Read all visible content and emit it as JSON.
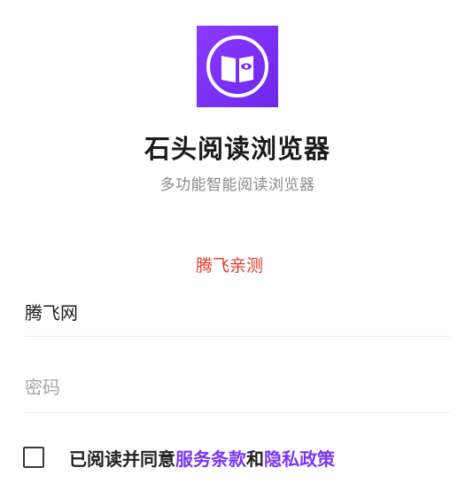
{
  "app": {
    "title": "石头阅读浏览器",
    "subtitle": "多功能智能阅读浏览器",
    "logo_icon": "open-book-eye-icon",
    "brand_color": "#7b2ff5"
  },
  "notice": "腾飞亲测",
  "form": {
    "username_value": "腾飞网",
    "password_placeholder": "密码"
  },
  "agreement": {
    "prefix": "已阅读并同意",
    "terms_link": "服务条款",
    "joiner": "和",
    "privacy_link": "隐私政策",
    "checked": false
  }
}
